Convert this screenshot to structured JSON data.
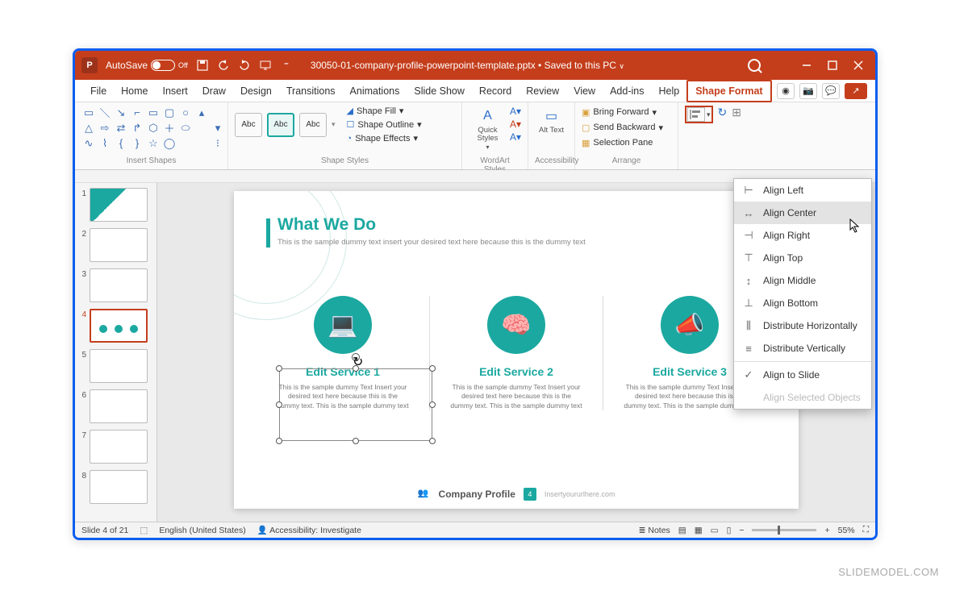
{
  "titlebar": {
    "autosave_label": "AutoSave",
    "autosave_state": "Off",
    "filename": "30050-01-company-profile-powerpoint-template.pptx",
    "save_status": "Saved to this PC"
  },
  "ribbon_tabs": [
    "File",
    "Home",
    "Insert",
    "Draw",
    "Design",
    "Transitions",
    "Animations",
    "Slide Show",
    "Record",
    "Review",
    "View",
    "Add-ins",
    "Help",
    "Shape Format"
  ],
  "ribbon_active_tab": "Shape Format",
  "ribbon": {
    "groups": {
      "insert_shapes": "Insert Shapes",
      "shape_styles": "Shape Styles",
      "wordart_styles": "WordArt Styles",
      "accessibility": "Accessibility",
      "arrange": "Arrange"
    },
    "style_sample": "Abc",
    "shape_fill": "Shape Fill",
    "shape_outline": "Shape Outline",
    "shape_effects": "Shape Effects",
    "quick_styles": "Quick Styles",
    "alt_text": "Alt Text",
    "bring_forward": "Bring Forward",
    "send_backward": "Send Backward",
    "selection_pane": "Selection Pane"
  },
  "align_menu": {
    "items": [
      {
        "label": "Align Left",
        "icon": "⊢"
      },
      {
        "label": "Align Center",
        "icon": "↔",
        "hover": true
      },
      {
        "label": "Align Right",
        "icon": "⊣"
      },
      {
        "label": "Align Top",
        "icon": "⊤"
      },
      {
        "label": "Align Middle",
        "icon": "↕"
      },
      {
        "label": "Align Bottom",
        "icon": "⊥"
      },
      {
        "label": "Distribute Horizontally",
        "icon": "⫼"
      },
      {
        "label": "Distribute Vertically",
        "icon": "≡"
      }
    ],
    "align_to_slide": "Align to Slide",
    "align_selected": "Align Selected Objects"
  },
  "thumbnails": {
    "count": 8,
    "active": 4
  },
  "slide": {
    "title": "What We Do",
    "subtitle": "This is the sample dummy text insert your desired text here because this is the dummy text",
    "services": [
      {
        "heading": "Edit Service 1",
        "text": "This is the sample dummy Text Insert your desired text here because this is the dummy text. This is the sample dummy text"
      },
      {
        "heading": "Edit Service 2",
        "text": "This is the sample dummy Text Insert your desired text here because this is the dummy text. This is the sample dummy text"
      },
      {
        "heading": "Edit Service 3",
        "text": "This is the sample dummy Text Insert your desired text here because this is the dummy text. This is the sample dummy text"
      }
    ],
    "footer_name": "Company Profile",
    "footer_page": "4",
    "footer_url": "Insertyoururlhere.com"
  },
  "statusbar": {
    "slide_info": "Slide 4 of 21",
    "language": "English (United States)",
    "accessibility": "Accessibility: Investigate",
    "notes": "Notes",
    "zoom": "55%"
  },
  "watermark": "SLIDEMODEL.COM",
  "colors": {
    "accent": "#c43e1c",
    "teal": "#1ba8a0"
  }
}
